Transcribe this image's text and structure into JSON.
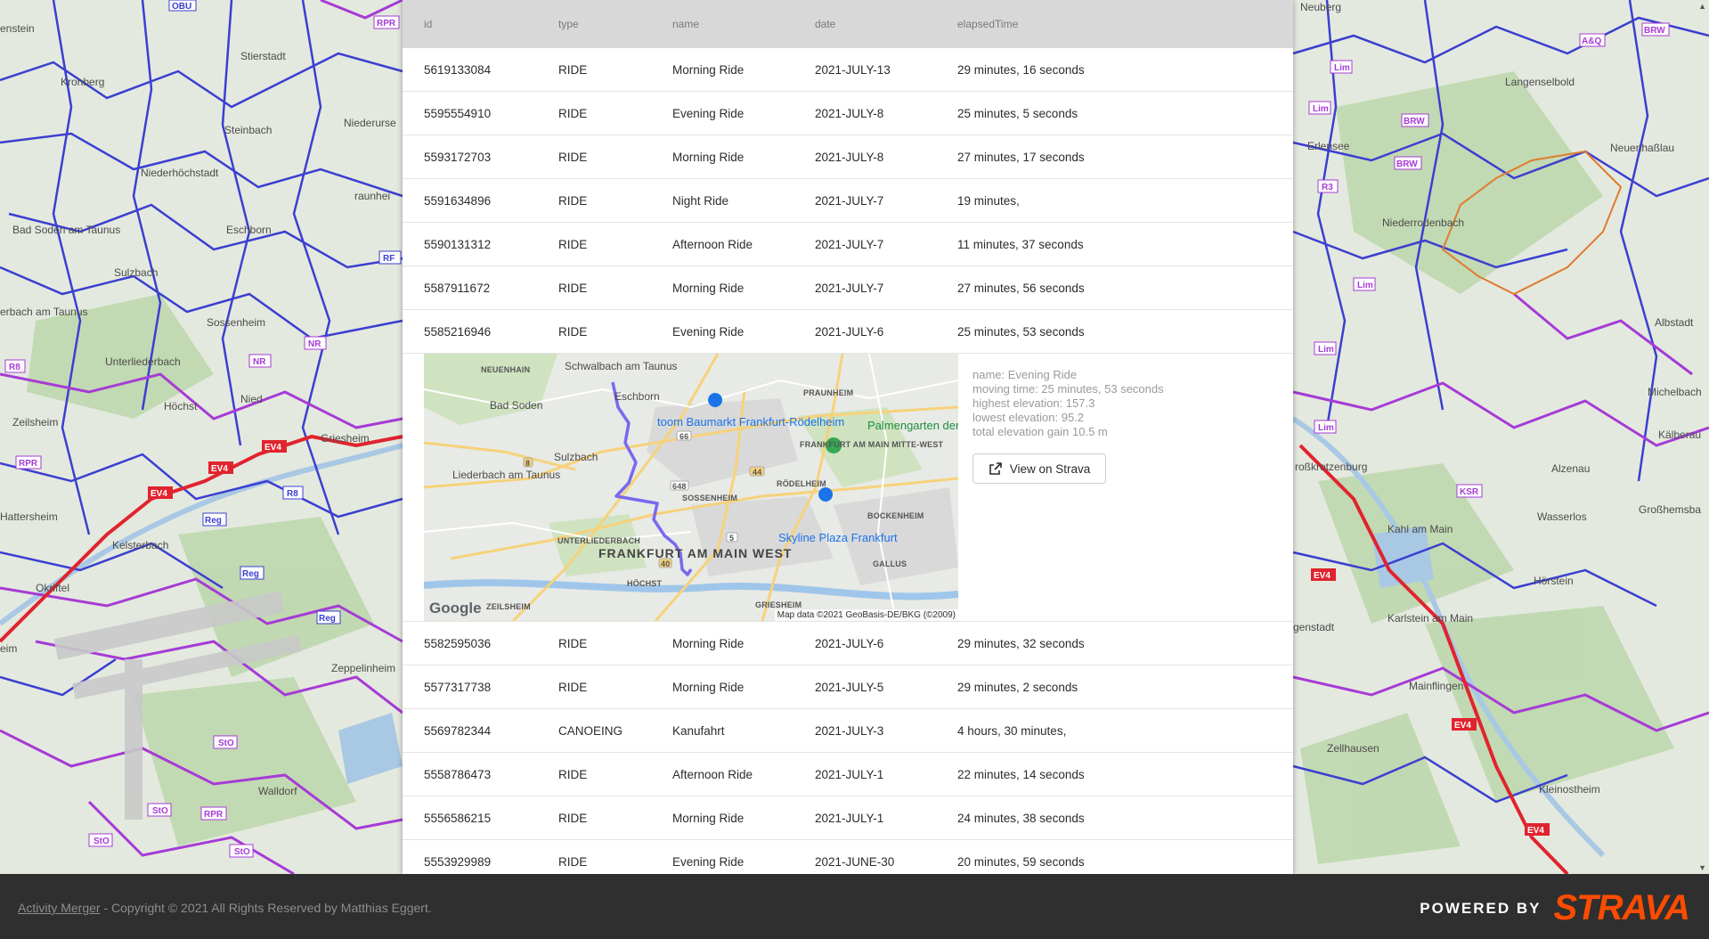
{
  "table": {
    "headers": [
      "id",
      "type",
      "name",
      "date",
      "elapsedTime"
    ],
    "rows_before": [
      {
        "id": "5619133084",
        "type": "RIDE",
        "name": "Morning Ride",
        "date": "2021-JULY-13",
        "time": "29 minutes, 16 seconds"
      },
      {
        "id": "5595554910",
        "type": "RIDE",
        "name": "Evening Ride",
        "date": "2021-JULY-8",
        "time": "25 minutes, 5 seconds"
      },
      {
        "id": "5593172703",
        "type": "RIDE",
        "name": "Morning Ride",
        "date": "2021-JULY-8",
        "time": "27 minutes, 17 seconds"
      },
      {
        "id": "5591634896",
        "type": "RIDE",
        "name": "Night Ride",
        "date": "2021-JULY-7",
        "time": "19 minutes,"
      },
      {
        "id": "5590131312",
        "type": "RIDE",
        "name": "Afternoon Ride",
        "date": "2021-JULY-7",
        "time": "11 minutes, 37 seconds"
      },
      {
        "id": "5587911672",
        "type": "RIDE",
        "name": "Morning Ride",
        "date": "2021-JULY-7",
        "time": "27 minutes, 56 seconds"
      },
      {
        "id": "5585216946",
        "type": "RIDE",
        "name": "Evening Ride",
        "date": "2021-JULY-6",
        "time": "25 minutes, 53 seconds"
      }
    ],
    "rows_after": [
      {
        "id": "5582595036",
        "type": "RIDE",
        "name": "Morning Ride",
        "date": "2021-JULY-6",
        "time": "29 minutes, 32 seconds"
      },
      {
        "id": "5577317738",
        "type": "RIDE",
        "name": "Morning Ride",
        "date": "2021-JULY-5",
        "time": "29 minutes, 2 seconds"
      },
      {
        "id": "5569782344",
        "type": "CANOEING",
        "name": "Kanufahrt",
        "date": "2021-JULY-3",
        "time": "4 hours, 30 minutes,"
      },
      {
        "id": "5558786473",
        "type": "RIDE",
        "name": "Afternoon Ride",
        "date": "2021-JULY-1",
        "time": "22 minutes, 14 seconds"
      },
      {
        "id": "5556586215",
        "type": "RIDE",
        "name": "Morning Ride",
        "date": "2021-JULY-1",
        "time": "24 minutes, 38 seconds"
      },
      {
        "id": "5553929989",
        "type": "RIDE",
        "name": "Evening Ride",
        "date": "2021-JUNE-30",
        "time": "20 minutes, 59 seconds"
      }
    ]
  },
  "detail": {
    "info": [
      "name: Evening Ride",
      "moving time: 25 minutes, 53 seconds",
      "highest elevation: 157.3",
      "lowest elevation: 95.2",
      "total elevation gain 10.5 m"
    ],
    "button_label": "View on Strava",
    "button_icon": "external-link-icon",
    "map": {
      "labels": {
        "neuenhain": "NEUENHAIN",
        "schwalbach": "Schwalbach am Taunus",
        "eschborn": "Eschborn",
        "praunheim": "PRAUNHEIM",
        "bad_soden": "Bad Soden",
        "toom": "toom Baumarkt Frankfurt-Rödelheim",
        "palmengarten": "Palmengarten der Stadt Frankfurt am Main",
        "frankfurt_mitte_west": "FRANKFURT AM MAIN MITTE-WEST",
        "sulzbach": "Sulzbach",
        "liederbach": "Liederbach am Taunus",
        "roedelheim": "RÖDELHEIM",
        "sossenheim": "SOSSENHEIM",
        "bockenheim": "BOCKENHEIM",
        "unterliederbach": "UNTERLIEDERBACH",
        "skyline": "Skyline Plaza Frankfurt",
        "frankfurt_west": "FRANKFURT AM MAIN WEST",
        "gallus": "GALLUS",
        "hoechst": "HÖCHST",
        "zeilsheim": "ZEILSHEIM",
        "griesheim": "GRIESHEIM",
        "road_66": "66",
        "road_648": "648",
        "road_44": "44",
        "road_8": "8",
        "road_5": "5",
        "road_40": "40"
      },
      "google_logo": "Google",
      "attribution": "Map data ©2021 GeoBasis-DE/BKG (©2009)",
      "route_color": "#7b68ee"
    }
  },
  "background_map": {
    "labels": {
      "stierstadt": "Stierstadt",
      "kronberg": "Kronberg",
      "steinbach": "Steinbach",
      "niederursel": "Niederurse",
      "niederhoechstadt": "Niederhöchstadt",
      "bad_soden_taunus": "Bad Soden am Taunus",
      "eschborn": "Eschborn",
      "sulzbach": "Sulzbach",
      "sossenheim": "Sossenheim",
      "unterliederbach": "Unterliederbach",
      "hoechst": "Höchst",
      "nied": "Nied",
      "zeilsheim": "Zeilsheim",
      "griesheim": "Griesheim",
      "hattersheim": "Hattersheim",
      "kelsterbach": "Kelsterbach",
      "okriftel": "Okriftel",
      "zeppelinheim": "Zeppelinheim",
      "walldorf": "Walldorf",
      "neuberg": "Neuberg",
      "langenselbold": "Langenselbold",
      "erlensee": "Erlensee",
      "neuenhasslau": "Neuenhaßlau",
      "niederrodenbach": "Niederrodenbach",
      "albstadt": "Albstadt",
      "michelbach": "Michelbach",
      "kaelberau": "Kälberau",
      "grosskrotzenburg": "roßkrotzenburg",
      "alzenau": "Alzenau",
      "wasserlos": "Wasserlos",
      "grosshemsbach": "Großhemsba",
      "kahl": "Kahl am Main",
      "hoerstein": "Hörstein",
      "karlstein": "Karlstein am Main",
      "genstadt": "genstadt",
      "mainflingen": "Mainflingen",
      "zellhausen": "Zellhausen",
      "kleinostheim": "Kleinostheim",
      "enstein": "enstein",
      "rauheim": "raunhei",
      "erbach": "erbach am Taunus",
      "ei": "eim"
    },
    "route_colors": {
      "blue": "#3b3fd0",
      "purple": "#a63bd6",
      "red": "#e0242e",
      "orange": "#e07b2e"
    }
  },
  "footer": {
    "link": "Activity Merger",
    "text": " - Copyright © 2021 All Rights Reserved by Matthias Eggert.",
    "powered_by": "POWERED BY",
    "strava": "STRAVA"
  },
  "scrollbar": {
    "up": "▲",
    "down": "▼"
  }
}
